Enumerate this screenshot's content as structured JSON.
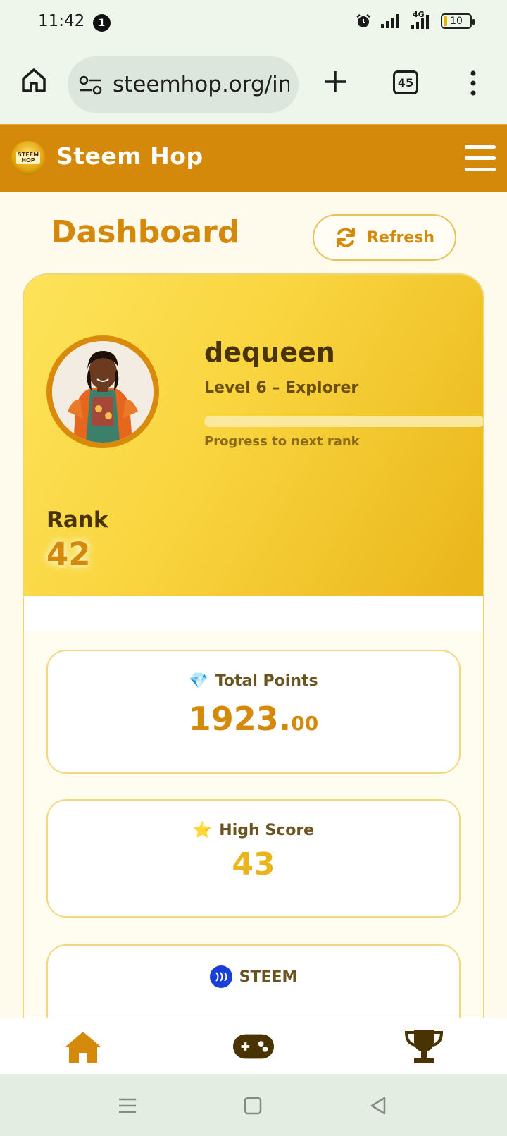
{
  "status_bar": {
    "time": "11:42",
    "notification_count": "1",
    "network_label": "4G",
    "battery_level": "10"
  },
  "browser": {
    "url": "steemhop.org/inc",
    "tab_count": "45"
  },
  "site": {
    "title": "Steem Hop",
    "logo_text_top": "STEEM",
    "logo_text_bottom": "HOP"
  },
  "dashboard": {
    "title": "Dashboard",
    "refresh_label": "Refresh"
  },
  "profile": {
    "username": "dequeen",
    "level_text": "Level 6 – Explorer",
    "progress_label": "Progress to next rank",
    "progress_fraction": 0,
    "rank_label": "Rank",
    "rank_value": "42"
  },
  "stats": {
    "points": {
      "icon": "💎",
      "label": "Total Points",
      "whole": "1923.",
      "decimal": "00"
    },
    "high_score": {
      "icon": "⭐",
      "label": "High Score",
      "value": "43"
    },
    "steem": {
      "label": "STEEM"
    }
  },
  "colors": {
    "brand": "#d4890a",
    "header_bg": "#d4890a",
    "accent_yellow": "#e9b51a",
    "dark_text": "#4a3303",
    "steem_blue": "#1a3fd6"
  },
  "nav": {
    "items": [
      "home-icon",
      "gamepad-icon",
      "trophy-icon"
    ]
  }
}
